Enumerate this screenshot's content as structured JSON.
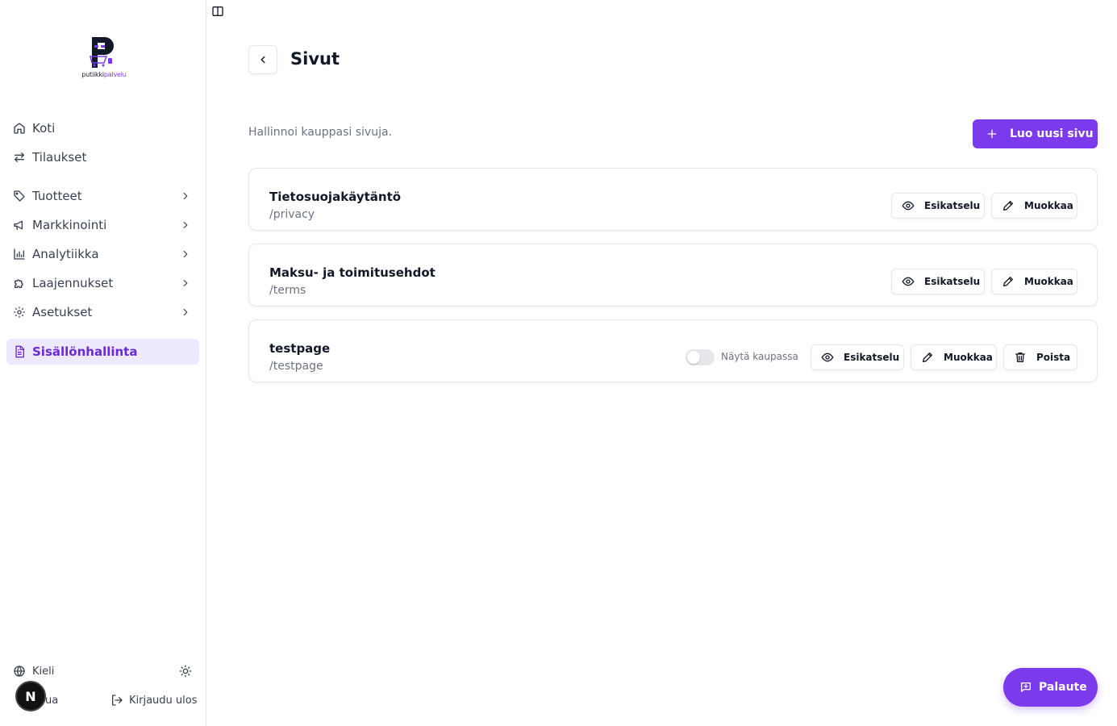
{
  "brand": {
    "name_prefix": "putiikki",
    "name_accent": "palvelu",
    "accent_color": "#7c3aed"
  },
  "sidebar": {
    "items": [
      {
        "label": "Koti",
        "icon": "home-icon",
        "has_chevron": false
      },
      {
        "label": "Tilaukset",
        "icon": "arrows-exchange-icon",
        "has_chevron": false
      },
      {
        "label": "Tuotteet",
        "icon": "tag-icon",
        "has_chevron": true
      },
      {
        "label": "Markkinointi",
        "icon": "megaphone-icon",
        "has_chevron": true
      },
      {
        "label": "Analytiikka",
        "icon": "bar-chart-icon",
        "has_chevron": true
      },
      {
        "label": "Laajennukset",
        "icon": "puzzle-icon",
        "has_chevron": true
      },
      {
        "label": "Asetukset",
        "icon": "gear-icon",
        "has_chevron": true
      },
      {
        "label": "Sisällönhallinta",
        "icon": "document-icon",
        "has_chevron": false,
        "active": true
      }
    ],
    "language_label": "Kieli",
    "help_label_partial": "ua",
    "logout_label": "Kirjaudu ulos",
    "avatar_letter": "N"
  },
  "header": {
    "title": "Sivut"
  },
  "main": {
    "subtitle": "Hallinnoi kauppasi sivuja.",
    "create_label": "Luo uusi sivu",
    "pages": [
      {
        "title": "Tietosuojakäytäntö",
        "slug": "/privacy"
      },
      {
        "title": "Maksu- ja toimitusehdot",
        "slug": "/terms"
      },
      {
        "title": "testpage",
        "slug": "/testpage",
        "show_in_store_label": "Näytä kaupassa",
        "show_in_store": false
      }
    ],
    "preview_label": "Esikatselu",
    "edit_label": "Muokkaa",
    "delete_label": "Poista"
  },
  "feedback": {
    "label": "Palaute"
  }
}
